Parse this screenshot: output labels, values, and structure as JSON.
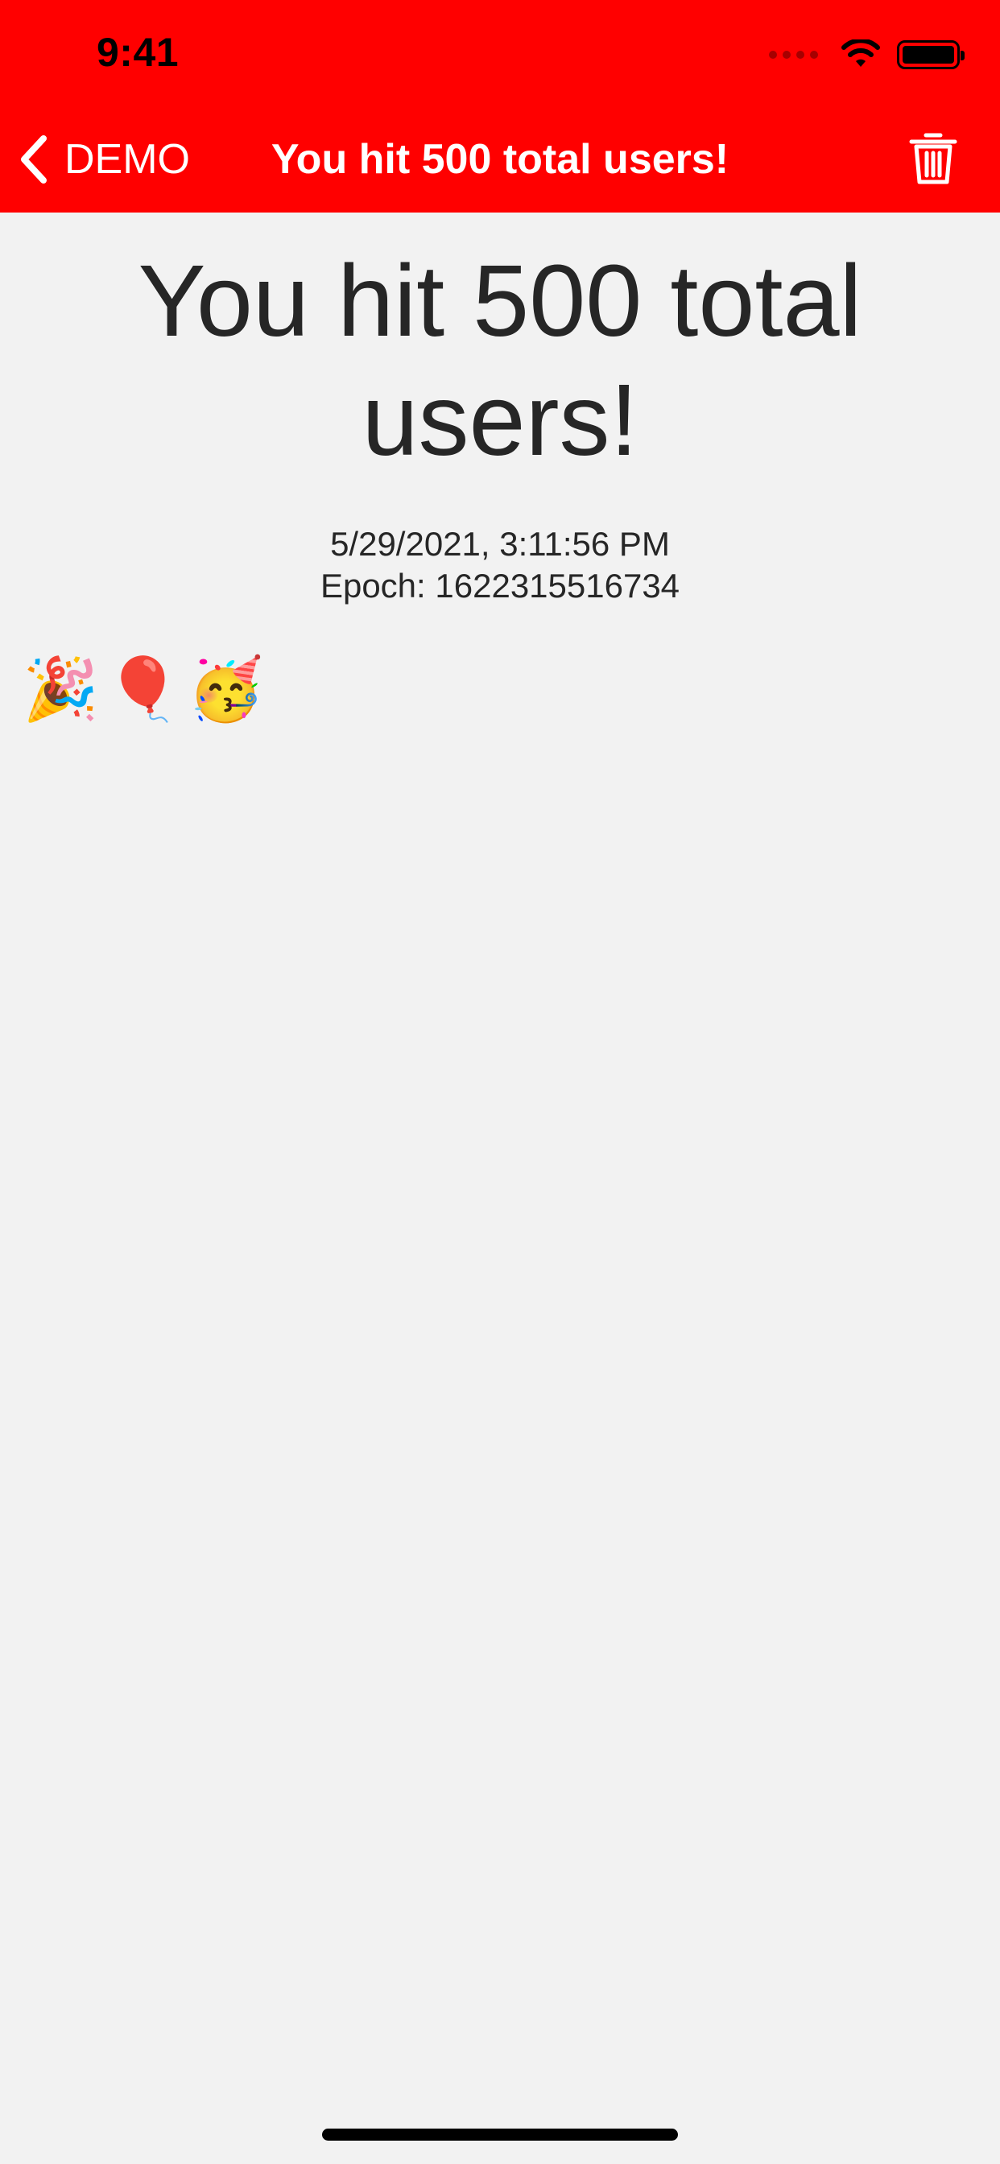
{
  "status_bar": {
    "time": "9:41",
    "icons": [
      "cellular-signal-icon",
      "wifi-icon",
      "battery-icon"
    ]
  },
  "nav": {
    "back_label": "DEMO",
    "title": "You hit 500 total users!",
    "back_icon": "chevron-left-icon",
    "action_icon": "trash-icon"
  },
  "content": {
    "headline": "You hit 500 total users!",
    "date": "5/29/2021, 3:11:56 PM",
    "epoch": "Epoch: 1622315516734",
    "emoji": [
      "🎉",
      "🎈",
      "🥳"
    ]
  },
  "colors": {
    "header_background": "#ff0000",
    "page_background": "#f2f2f2",
    "text": "#262626"
  }
}
